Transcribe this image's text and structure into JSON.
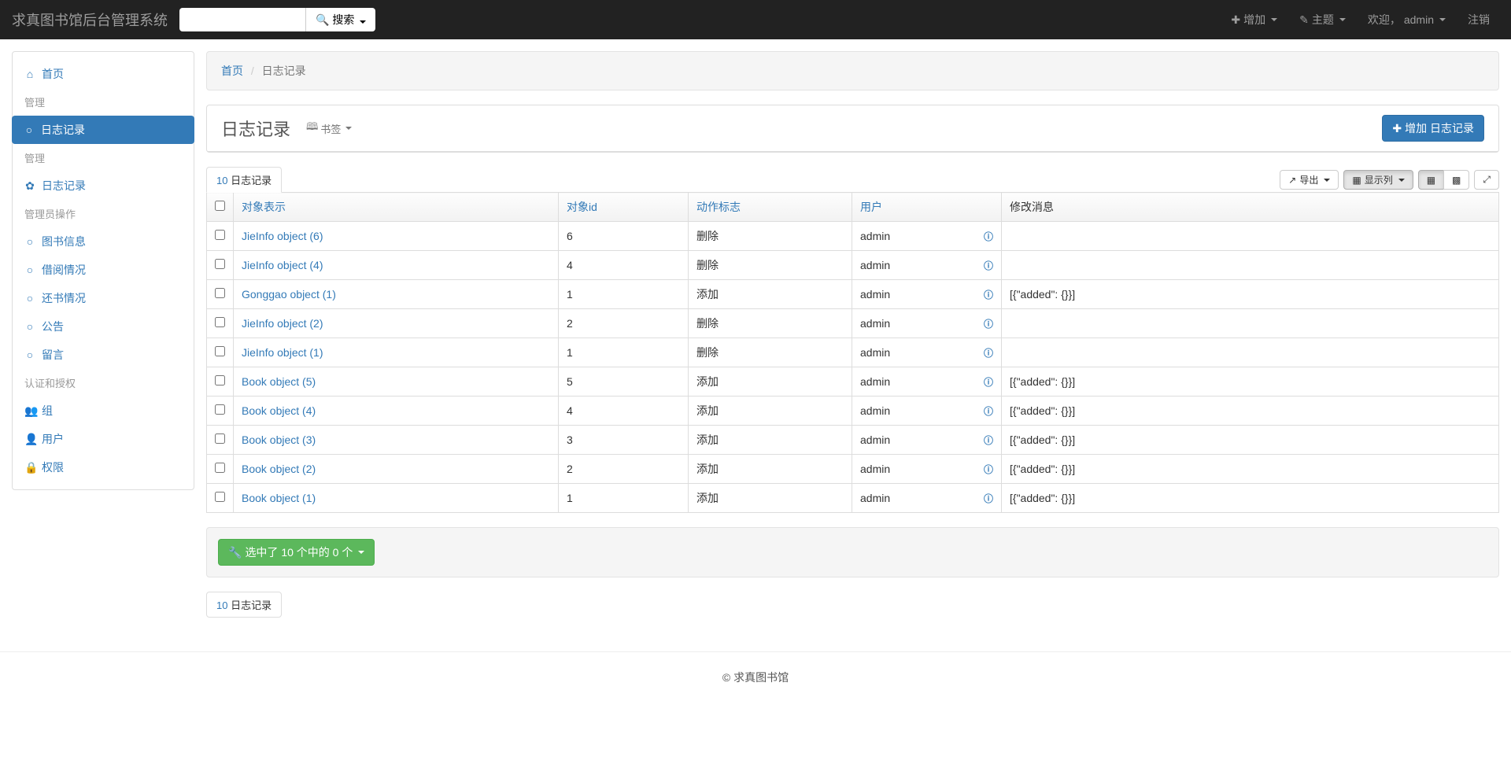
{
  "brand": "求真图书馆后台管理系统",
  "search": {
    "placeholder": "",
    "button": "搜索"
  },
  "nav": {
    "add": "增加",
    "theme": "主题",
    "welcome": "欢迎，",
    "user": "admin",
    "logout": "注销"
  },
  "sidebar": {
    "home": "首页",
    "g1": "管理",
    "log_records_active": "日志记录",
    "g2": "管理",
    "log_records": "日志记录",
    "g3": "管理员操作",
    "book_info": "图书信息",
    "borrow": "借阅情况",
    "return": "还书情况",
    "announce": "公告",
    "message": "留言",
    "g4": "认证和授权",
    "groups": "组",
    "users": "用户",
    "perms": "权限"
  },
  "breadcrumb": {
    "home": "首页",
    "current": "日志记录"
  },
  "page": {
    "title": "日志记录",
    "bookmark": "书签",
    "add_btn": "增加 日志记录"
  },
  "toolbar": {
    "count_num": "10",
    "count_label": "日志记录",
    "export": "导出",
    "show_cols": "显示列"
  },
  "columns": {
    "repr": "对象表示",
    "obj_id": "对象id",
    "action": "动作标志",
    "user": "用户",
    "msg": "修改消息"
  },
  "rows": [
    {
      "repr": "JieInfo object (6)",
      "obj_id": "6",
      "action": "删除",
      "user": "admin",
      "msg": ""
    },
    {
      "repr": "JieInfo object (4)",
      "obj_id": "4",
      "action": "删除",
      "user": "admin",
      "msg": ""
    },
    {
      "repr": "Gonggao object (1)",
      "obj_id": "1",
      "action": "添加",
      "user": "admin",
      "msg": "[{\"added\": {}}]"
    },
    {
      "repr": "JieInfo object (2)",
      "obj_id": "2",
      "action": "删除",
      "user": "admin",
      "msg": ""
    },
    {
      "repr": "JieInfo object (1)",
      "obj_id": "1",
      "action": "删除",
      "user": "admin",
      "msg": ""
    },
    {
      "repr": "Book object (5)",
      "obj_id": "5",
      "action": "添加",
      "user": "admin",
      "msg": "[{\"added\": {}}]"
    },
    {
      "repr": "Book object (4)",
      "obj_id": "4",
      "action": "添加",
      "user": "admin",
      "msg": "[{\"added\": {}}]"
    },
    {
      "repr": "Book object (3)",
      "obj_id": "3",
      "action": "添加",
      "user": "admin",
      "msg": "[{\"added\": {}}]"
    },
    {
      "repr": "Book object (2)",
      "obj_id": "2",
      "action": "添加",
      "user": "admin",
      "msg": "[{\"added\": {}}]"
    },
    {
      "repr": "Book object (1)",
      "obj_id": "1",
      "action": "添加",
      "user": "admin",
      "msg": "[{\"added\": {}}]"
    }
  ],
  "selected": "选中了 10 个中的 0 个",
  "footer": "© 求真图书馆"
}
